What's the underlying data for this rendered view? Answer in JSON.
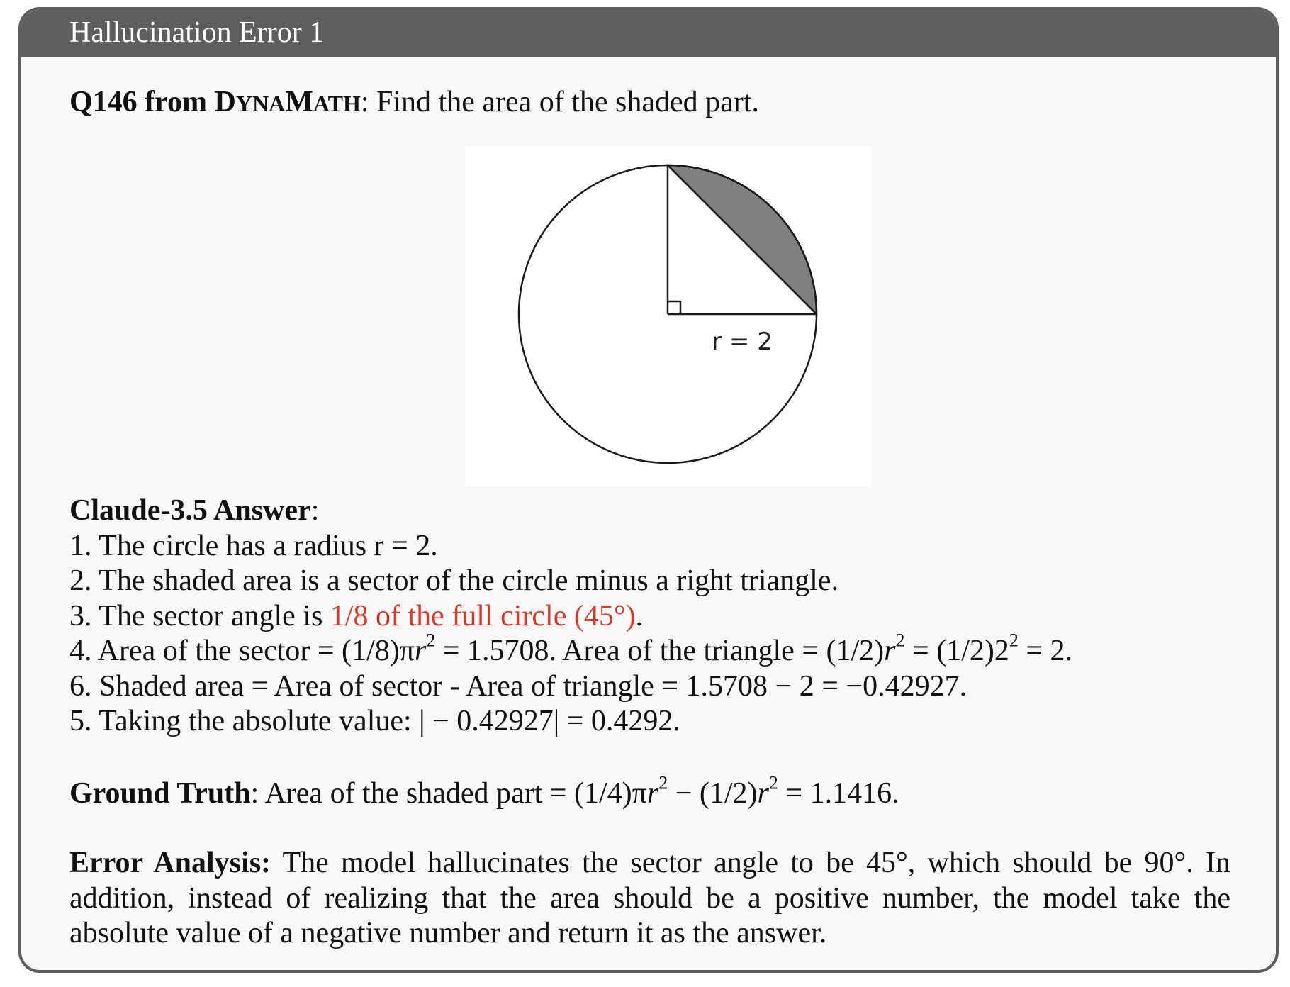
{
  "header": {
    "title": "Hallucination Error 1"
  },
  "question": {
    "id": "Q146 from",
    "source_first": "D",
    "source_small_1": "YNA",
    "source_m": "M",
    "source_small_2": "ATH",
    "colon": ":",
    "text": "Find the area of the shaded part."
  },
  "figure": {
    "radius_label": "r = 2",
    "shade_color": "#808080",
    "stroke_color": "#1a1a1a"
  },
  "answer": {
    "label": "Claude-3.5 Answer",
    "colon": ":",
    "lines": [
      "1. The circle has a radius r = 2.",
      "2. The shaded area is a sector of the circle minus a right triangle."
    ],
    "line3_prefix": "3. The sector angle is ",
    "line3_highlight": "1/8 of the full circle (45°)",
    "line3_suffix": ".",
    "line4_a": "4. Area of the sector = (1/8)π",
    "line4_r": "r",
    "line4_exp": "2",
    "line4_b": " = 1.5708. Area of the triangle = (1/2)",
    "line4_r2": "r",
    "line4_exp2": "2",
    "line4_c": " = (1/2)2",
    "line4_exp3": "2",
    "line4_d": " = 2.",
    "line6": "6. Shaded area = Area of sector - Area of triangle = 1.5708 − 2 = −0.42927.",
    "line5": "5. Taking the absolute value: | − 0.42927| = 0.4292."
  },
  "ground_truth": {
    "label": "Ground Truth",
    "colon": ":",
    "text_a": " Area of the shaded part = (1/4)π",
    "r1": "r",
    "exp1": "2",
    "text_b": " − (1/2)",
    "r2": "r",
    "exp2": "2",
    "text_c": " = 1.1416."
  },
  "error_analysis": {
    "label": "Error Analysis:",
    "text": " The model hallucinates the sector angle to be 45°, which should be 90°. In addition, instead of realizing that the area should be a positive number, the model take the absolute value of a negative number and return it as the answer."
  }
}
